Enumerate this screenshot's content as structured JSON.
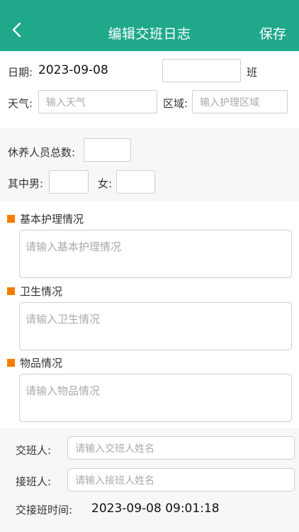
{
  "navbar": {
    "title": "编辑交班日志",
    "save_label": "保存",
    "back_icon": "chevron-left-icon",
    "background": "#1fa88a"
  },
  "basic": {
    "date_label": "日期:",
    "date_value": "2023-09-08",
    "shift_suffix": "班",
    "weather_label": "天气:",
    "weather_placeholder": "输入天气",
    "area_label": "区域:",
    "area_placeholder": "输入护理区域"
  },
  "residents": {
    "total_label": "休养人员总数:",
    "male_label": "其中男:",
    "female_label": "女:"
  },
  "sections": [
    {
      "title": "基本护理情况",
      "placeholder": "请输入基本护理情况"
    },
    {
      "title": "卫生情况",
      "placeholder": "请输入卫生情况"
    },
    {
      "title": "物品情况",
      "placeholder": "请输入物品情况"
    }
  ],
  "handover": {
    "giver_label": "交班人:",
    "giver_placeholder": "请输入交班人姓名",
    "receiver_label": "接班人:",
    "receiver_placeholder": "请输入接班人姓名",
    "time_label": "交接班时间:",
    "time_value": "2023-09-08 09:01:18"
  },
  "colors": {
    "accent": "#1fa88a",
    "section_marker": "#f57c00"
  }
}
